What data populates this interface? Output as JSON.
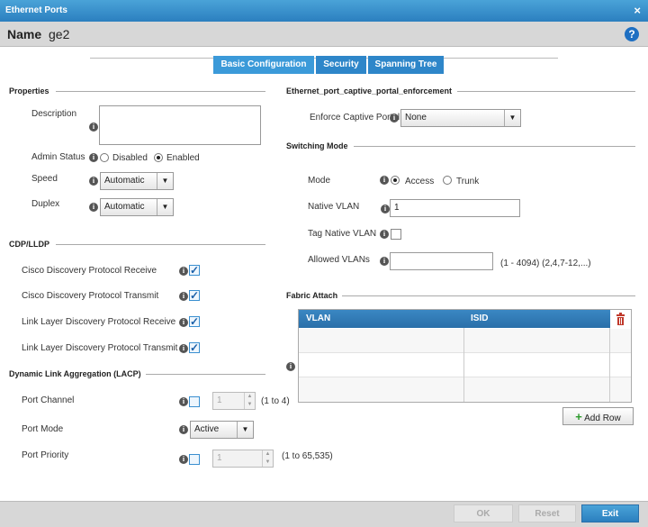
{
  "window": {
    "title": "Ethernet Ports",
    "close": "×"
  },
  "name_bar": {
    "label": "Name",
    "value": "ge2",
    "help": "?"
  },
  "tabs": [
    "Basic Configuration",
    "Security",
    "Spanning Tree"
  ],
  "properties": {
    "heading": "Properties",
    "description_label": "Description",
    "description_value": "",
    "admin_status_label": "Admin Status",
    "admin_disabled": "Disabled",
    "admin_enabled": "Enabled",
    "speed_label": "Speed",
    "speed_value": "Automatic",
    "duplex_label": "Duplex",
    "duplex_value": "Automatic"
  },
  "cdp": {
    "heading": "CDP/LLDP",
    "items": [
      "Cisco Discovery Protocol Receive",
      "Cisco Discovery Protocol Transmit",
      "Link Layer Discovery Protocol Receive",
      "Link Layer Discovery Protocol Transmit"
    ]
  },
  "lacp": {
    "heading": "Dynamic Link Aggregation (LACP)",
    "port_channel_label": "Port Channel",
    "port_channel_value": "1",
    "port_channel_range": "(1 to 4)",
    "port_mode_label": "Port Mode",
    "port_mode_value": "Active",
    "port_priority_label": "Port Priority",
    "port_priority_value": "1",
    "port_priority_range": "(1 to 65,535)"
  },
  "captive": {
    "heading": "Ethernet_port_captive_portal_enforcement",
    "label": "Enforce Captive Portal",
    "value": "None"
  },
  "switching": {
    "heading": "Switching Mode",
    "mode_label": "Mode",
    "mode_access": "Access",
    "mode_trunk": "Trunk",
    "native_vlan_label": "Native VLAN",
    "native_vlan_value": "1",
    "tag_native_label": "Tag Native VLAN",
    "allowed_label": "Allowed VLANs",
    "allowed_value": "",
    "allowed_hint": "(1 - 4094)  (2,4,7-12,...)"
  },
  "fabric": {
    "heading": "Fabric Attach",
    "col_vlan": "VLAN",
    "col_isid": "ISID",
    "add_row": "Add Row"
  },
  "footer": {
    "ok": "OK",
    "reset": "Reset",
    "exit": "Exit"
  },
  "info_glyph": "i",
  "select_arrow": "▼",
  "check_glyph": "✓",
  "plus_glyph": "+",
  "spin_up": "▲",
  "spin_down": "▼"
}
